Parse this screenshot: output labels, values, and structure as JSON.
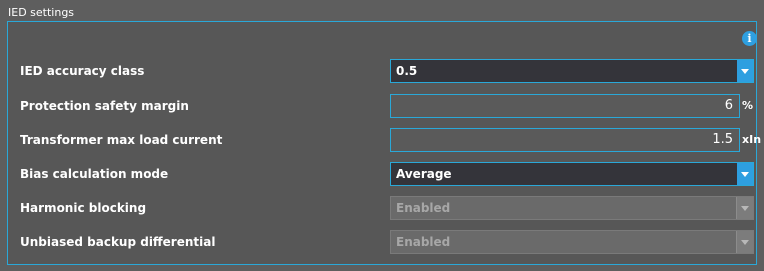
{
  "group": {
    "title": "IED settings"
  },
  "rows": [
    {
      "label": "IED accuracy class",
      "value": "0.5"
    },
    {
      "label": "Protection safety margin",
      "value": "6",
      "unit": "%"
    },
    {
      "label": "Transformer max load current",
      "value": "1.5",
      "unit": "xIn"
    },
    {
      "label": "Bias calculation mode",
      "value": "Average"
    },
    {
      "label": "Harmonic blocking",
      "value": "Enabled"
    },
    {
      "label": "Unbiased backup differential",
      "value": "Enabled"
    }
  ],
  "icons": {
    "info": "info-icon",
    "dropdown": "chevron-down-icon"
  },
  "colors": {
    "accent": "#2aa8d8",
    "panel": "#575757",
    "background": "#5e5e5e"
  }
}
